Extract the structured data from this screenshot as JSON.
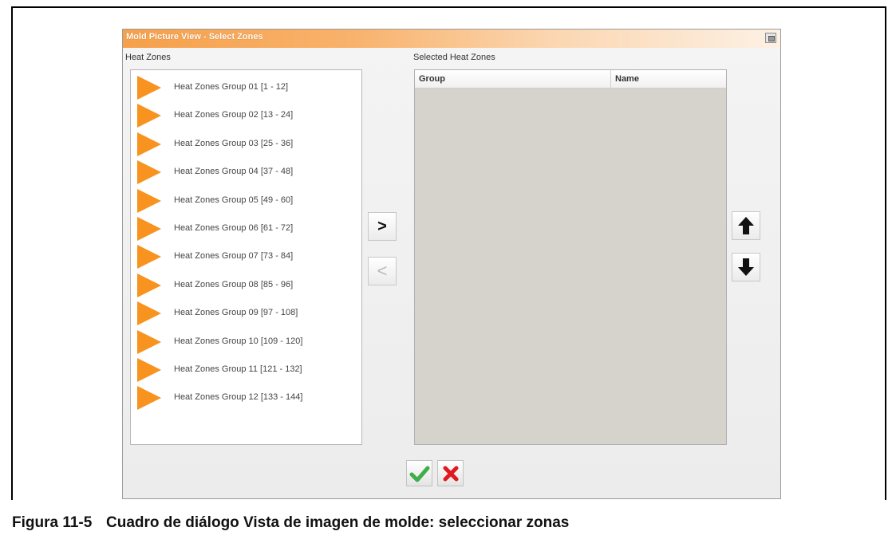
{
  "dialog": {
    "title": "Mold Picture View - Select Zones",
    "heat_zones_label": "Heat Zones",
    "selected_label": "Selected Heat Zones",
    "table_headers": [
      "Group",
      "Name"
    ],
    "zone_groups": [
      "Heat Zones Group 01 [1 - 12]",
      "Heat Zones Group 02 [13 - 24]",
      "Heat Zones Group 03 [25 - 36]",
      "Heat Zones Group 04 [37 - 48]",
      "Heat Zones Group 05 [49 - 60]",
      "Heat Zones Group 06 [61 - 72]",
      "Heat Zones Group 07 [73 - 84]",
      "Heat Zones Group 08 [85 - 96]",
      "Heat Zones Group 09 [97 - 108]",
      "Heat Zones Group 10 [109 - 120]",
      "Heat Zones Group 11 [121 - 132]",
      "Heat Zones Group 12 [133 - 144]"
    ],
    "add_label": ">",
    "remove_label": "<",
    "icons": {
      "zone": "triangle-right-icon",
      "move_up": "arrow-up-icon",
      "move_down": "arrow-down-icon",
      "ok": "checkmark-icon",
      "cancel": "x-icon"
    },
    "colors": {
      "zone_icon": "#f7931e",
      "title_bar": "#f6a04a",
      "ok": "#3fae49",
      "cancel": "#e0191f"
    }
  },
  "caption": {
    "number": "Figura 11-5",
    "text": "Cuadro de diálogo Vista de imagen de molde: seleccionar zonas"
  }
}
